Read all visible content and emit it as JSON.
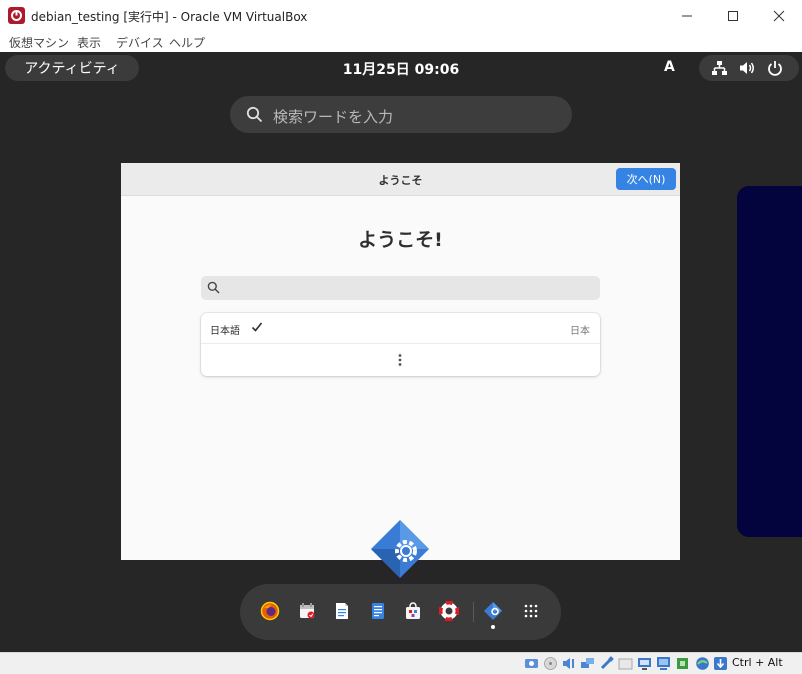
{
  "window": {
    "title": "debian_testing [実行中] - Oracle VM VirtualBox",
    "menu": [
      "仮想マシン",
      "表示",
      "デバイス",
      "ヘルプ"
    ]
  },
  "topbar": {
    "activities_label": "アクティビティ",
    "clock": "11月25日  09:06",
    "input_method": "A"
  },
  "overview": {
    "search_placeholder": "検索ワードを入力"
  },
  "welcome_window": {
    "header_title": "ようこそ",
    "next_button": "次へ(N)",
    "heading": "ようこそ!",
    "languages": [
      {
        "name": "日本語",
        "region": "日本",
        "selected": true
      }
    ]
  },
  "dash": {
    "apps": [
      "firefox-icon",
      "calendar-icon",
      "text-editor-icon",
      "documents-icon",
      "software-icon",
      "help-icon",
      "initial-setup-icon",
      "show-apps-icon"
    ]
  },
  "status_bar": {
    "host_key": "Ctrl + Alt"
  },
  "colors": {
    "accent": "#3584e4",
    "guest_background": "#262626",
    "side_window": "#03033d"
  }
}
